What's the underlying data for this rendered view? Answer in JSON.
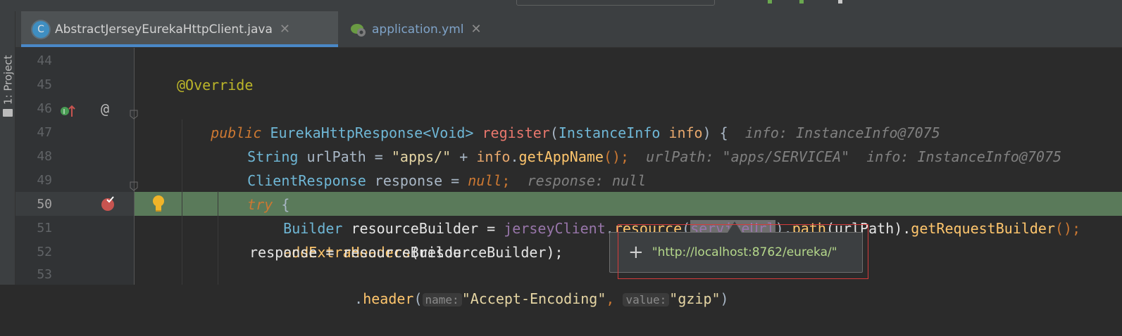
{
  "tabs": [
    {
      "label": "AbstractJerseyEurekaHttpClient.java",
      "icon": "java-class-icon",
      "active": true
    },
    {
      "label": "application.yml",
      "icon": "spring-yml-icon",
      "active": false
    }
  ],
  "sidebar": {
    "project_label": "1: Project"
  },
  "lines": [
    {
      "num": "44"
    },
    {
      "num": "45",
      "t1": "@Override"
    },
    {
      "num": "46",
      "kw": "public",
      "type": "EurekaHttpResponse<Void>",
      "meth": "register",
      "p1": "(",
      "ptype": "InstanceInfo",
      "pname": "info",
      "p2": ") {",
      "hint": "info: InstanceInfo@7075"
    },
    {
      "num": "47",
      "type": "String",
      "a": "urlPath = ",
      "str": "\"apps/\"",
      "b": " + ",
      "obj": "info",
      "dot": ".",
      "meth": "getAppName",
      "c": "();",
      "hint": "urlPath: \"apps/SERVICEA\"  info: InstanceInfo@7075"
    },
    {
      "num": "48",
      "type": "ClientResponse",
      "a": "response = ",
      "kw": "null",
      "c": ";",
      "hint": "response: null"
    },
    {
      "num": "49",
      "kw": "try",
      "c": " {"
    },
    {
      "num": "50",
      "type": "Builder",
      "a": "resourceBuilder = ",
      "fld": "jerseyClient",
      "dot": ".",
      "meth": "resource",
      "p1": "(",
      "sel": "serviceUrl",
      "p2": ").",
      "meth2": "path",
      "p3": "(urlPath).",
      "meth3": "getRequestBuilder",
      "c": "();"
    },
    {
      "num": "51",
      "meth": "addExtraHeaders",
      "c": "(resourceBuilder);"
    },
    {
      "num": "52",
      "a": "response = resourceBuilder"
    },
    {
      "num": "53",
      "dot": ".",
      "meth": "header",
      "p1": "(",
      "hint1": "name:",
      "str": "\"Accept-Encoding\"",
      "c": ",",
      "hint2": "value:",
      "str2": "\"gzip\"",
      "c2": ")"
    }
  ],
  "popup": {
    "value": "\"http://localhost:8762/eureka/\""
  }
}
